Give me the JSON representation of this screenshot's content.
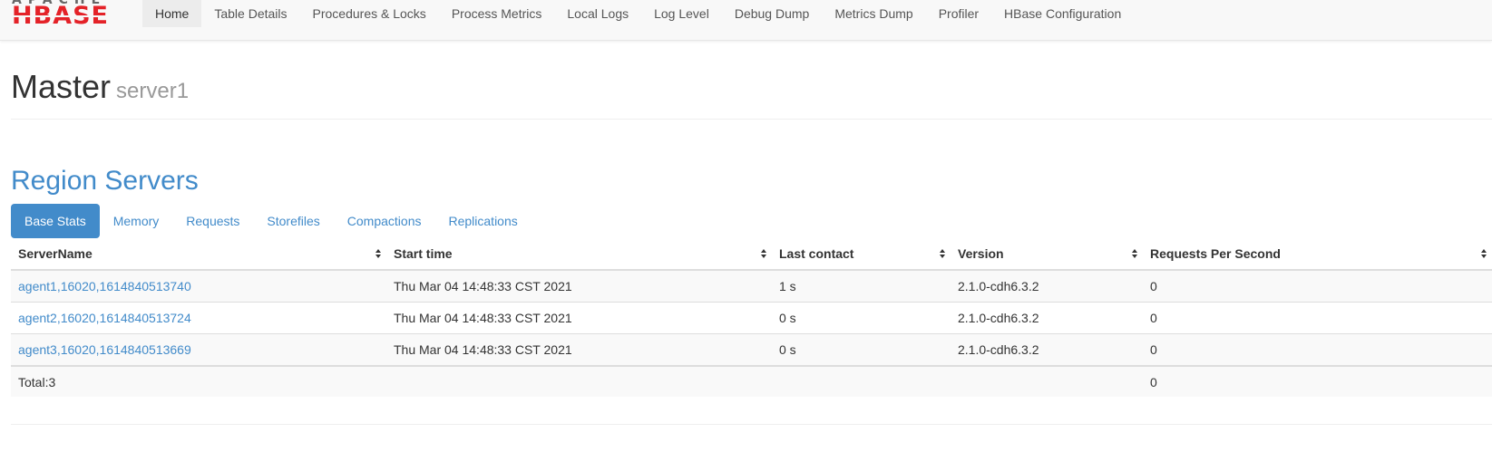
{
  "logo": {
    "top_text": "APACHE",
    "main_text": "HBASE"
  },
  "nav": {
    "items": [
      {
        "label": "Home",
        "active": true
      },
      {
        "label": "Table Details"
      },
      {
        "label": "Procedures & Locks"
      },
      {
        "label": "Process Metrics"
      },
      {
        "label": "Local Logs"
      },
      {
        "label": "Log Level"
      },
      {
        "label": "Debug Dump"
      },
      {
        "label": "Metrics Dump"
      },
      {
        "label": "Profiler"
      },
      {
        "label": "HBase Configuration"
      }
    ]
  },
  "header": {
    "title": "Master",
    "subtitle": "server1"
  },
  "region_servers": {
    "title": "Region Servers",
    "tabs": [
      {
        "label": "Base Stats",
        "active": true
      },
      {
        "label": "Memory"
      },
      {
        "label": "Requests"
      },
      {
        "label": "Storefiles"
      },
      {
        "label": "Compactions"
      },
      {
        "label": "Replications"
      }
    ],
    "columns": [
      "ServerName",
      "Start time",
      "Last contact",
      "Version",
      "Requests Per Second"
    ],
    "rows": [
      {
        "server": "agent1,16020,1614840513740",
        "start": "Thu Mar 04 14:48:33 CST 2021",
        "contact": "1 s",
        "version": "2.1.0-cdh6.3.2",
        "rps": "0"
      },
      {
        "server": "agent2,16020,1614840513724",
        "start": "Thu Mar 04 14:48:33 CST 2021",
        "contact": "0 s",
        "version": "2.1.0-cdh6.3.2",
        "rps": "0"
      },
      {
        "server": "agent3,16020,1614840513669",
        "start": "Thu Mar 04 14:48:33 CST 2021",
        "contact": "0 s",
        "version": "2.1.0-cdh6.3.2",
        "rps": "0"
      }
    ],
    "footer": {
      "total": "Total:3",
      "rps": "0"
    }
  },
  "colors": {
    "link": "#428bca",
    "logo_red": "#e42228",
    "navbar_bg": "#f8f8f8"
  }
}
